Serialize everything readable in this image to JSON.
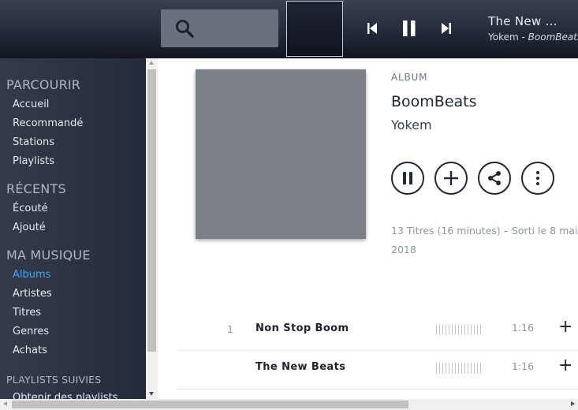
{
  "player": {
    "now_playing_title": "The New …",
    "now_playing_artist": "Yokem -",
    "now_playing_album": "BoomBeats"
  },
  "sidebar": {
    "sections": [
      {
        "title": "PARCOURIR",
        "items": [
          "Accueil",
          "Recommandé",
          "Stations",
          "Playlists"
        ]
      },
      {
        "title": "RÉCENTS",
        "items": [
          "Écouté",
          "Ajouté"
        ]
      },
      {
        "title": "MA MUSIQUE",
        "items": [
          "Albums",
          "Artistes",
          "Titres",
          "Genres",
          "Achats"
        ]
      },
      {
        "title": "PLAYLISTS SUIVIES",
        "items": [
          "Obtenir des playlists"
        ]
      }
    ],
    "active_item": "Albums"
  },
  "album": {
    "label": "ALBUM",
    "title": "BoomBeats",
    "artist": "Yokem",
    "meta_line1": "13 Titres (16 minutes)  –  Sorti le 8 mai",
    "meta_line2": "2018"
  },
  "tracks": [
    {
      "number": "1",
      "title": "Non Stop Boom",
      "duration": "1:16",
      "add": "+"
    },
    {
      "number": "",
      "title": "The New Beats",
      "duration": "1:16",
      "add": "+"
    }
  ],
  "icons": {
    "search": "search-icon",
    "previous": "skip-previous-icon",
    "pause": "pause-icon",
    "next": "skip-next-icon",
    "add": "plus-icon",
    "share": "share-icon",
    "more": "more-vertical-icon"
  },
  "colors": {
    "accent": "#4aa3e6",
    "sidebar_bg": "#2b3242",
    "topbar_bg": "#232a38"
  }
}
